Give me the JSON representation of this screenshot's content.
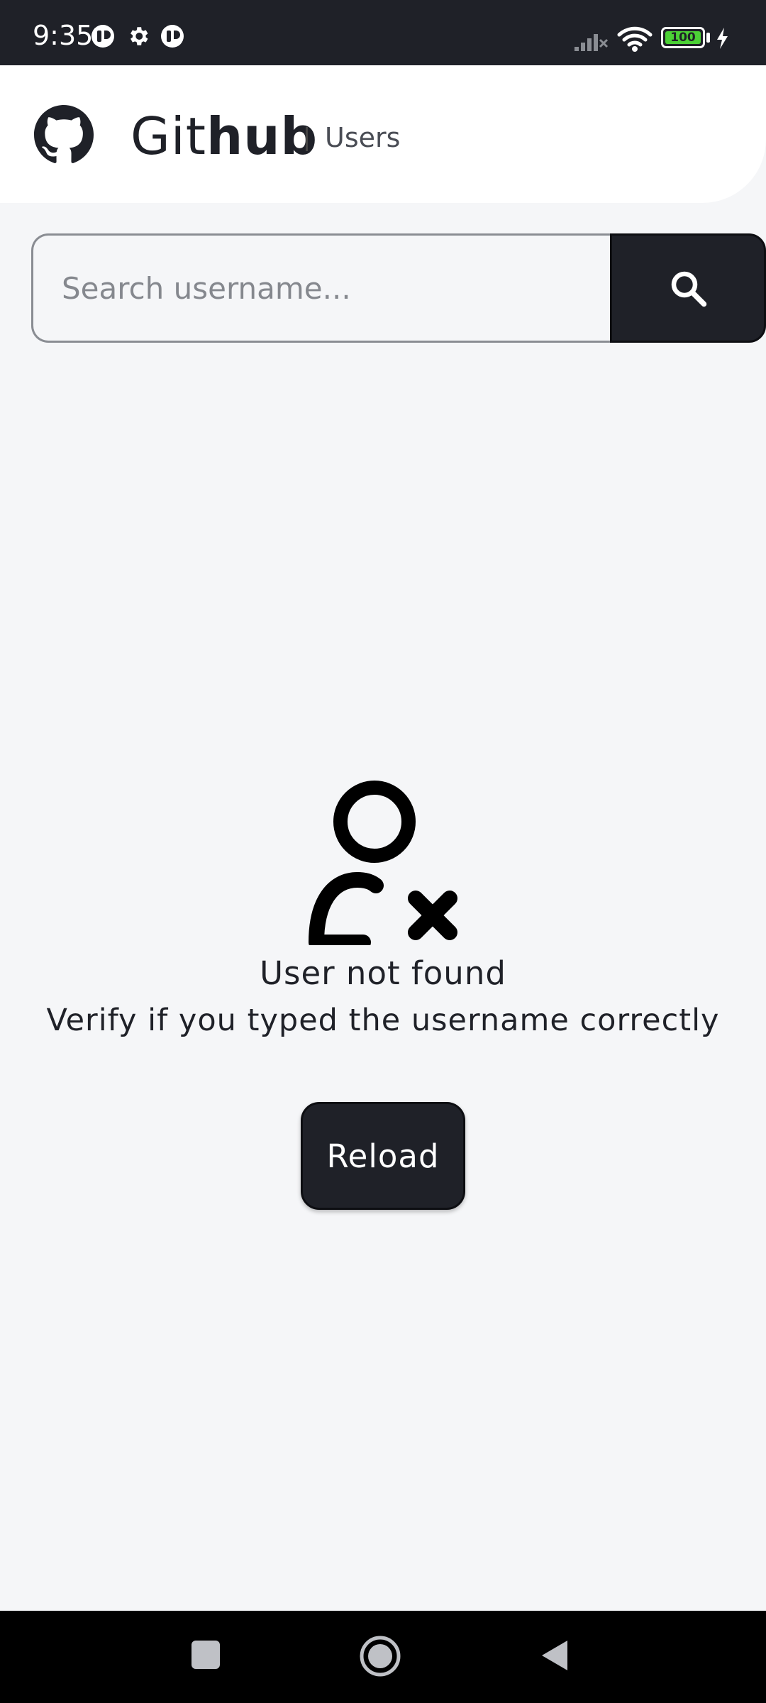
{
  "status_bar": {
    "time": "9:35",
    "battery_level": "100",
    "icons": [
      "app-notification-icon",
      "settings-icon",
      "app-notification-icon",
      "signal-icon",
      "wifi-icon",
      "battery-icon",
      "charging-icon"
    ]
  },
  "header": {
    "brand_light": "Git",
    "brand_bold": "hub",
    "section": "Users",
    "logo_icon": "github-logo-icon"
  },
  "search": {
    "placeholder": "Search username...",
    "value": "",
    "button_icon": "search-icon"
  },
  "empty_state": {
    "icon": "user-not-found-icon",
    "title": "User not found",
    "subtitle": "Verify if you typed the username correctly",
    "reload_label": "Reload"
  },
  "nav_bar": {
    "buttons": [
      "recents-icon",
      "home-icon",
      "back-icon"
    ]
  },
  "colors": {
    "primary": "#1f2128",
    "background": "#f5f6f8",
    "surface": "#ffffff",
    "battery": "#4cd136"
  }
}
